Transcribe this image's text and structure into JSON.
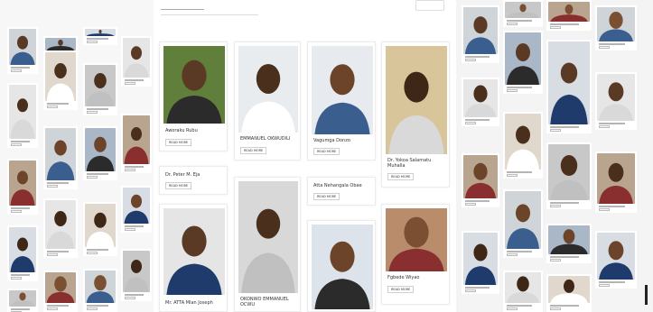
{
  "center": {
    "cards": [
      {
        "name": "Aworaku Rubu",
        "button": "READ MORE"
      },
      {
        "name": "EMMANUEL OKWUDILI",
        "button": "READ MORE"
      },
      {
        "name": "Vagumga Donzo",
        "button": "READ MORE"
      },
      {
        "name": "Dr. Yokoa Salamatu Muhalla",
        "button": "READ MORE"
      },
      {
        "name": "Dr. Peter M. Eja",
        "button": "READ MORE"
      },
      {
        "name": "Atta Nehangala Obae",
        "button": "READ MORE"
      },
      {
        "name": "Fgbede Wiyao",
        "button": "READ MORE"
      },
      {
        "name": "Mr. ATTA Mlan Joseph",
        "button": ""
      },
      {
        "name": "OKONWO EMMANUEL OCWU",
        "button": ""
      }
    ]
  },
  "colors": {
    "card_bg": "#ffffff",
    "page_bg": "#f4f4f4",
    "button_border": "#cfcfcf"
  },
  "icons": [
    "avatar-photo",
    "play-icon"
  ]
}
